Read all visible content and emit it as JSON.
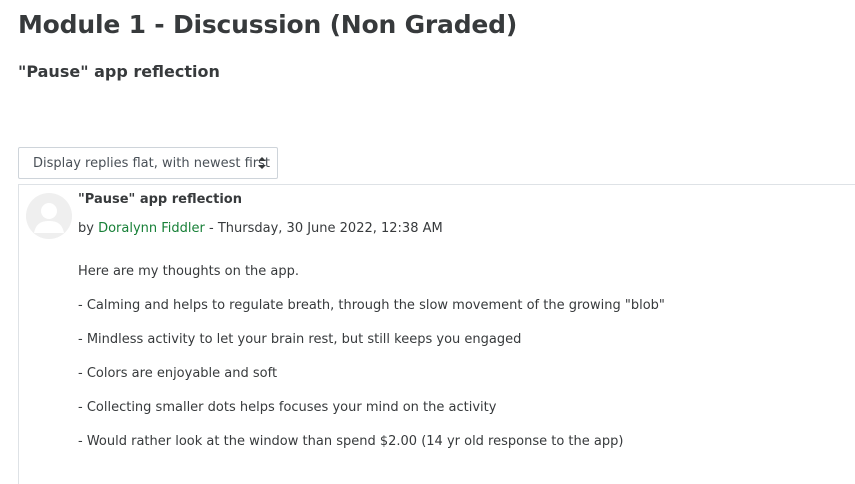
{
  "page": {
    "title": "Module 1 - Discussion (Non Graded)",
    "subtitle": "\"Pause\" app reflection"
  },
  "display_mode": {
    "selected": "Display replies flat, with newest first",
    "icon": "sort-caret-icon"
  },
  "post": {
    "subject": "\"Pause\" app reflection",
    "by_prefix": "by ",
    "author": "Doralynn Fiddler",
    "date_text": " - Thursday, 30 June 2022, 12:38 AM",
    "avatar_icon": "user-avatar-icon",
    "paragraphs": [
      "Here are my thoughts on the app.",
      "- Calming and helps to regulate breath, through the slow movement of the growing \"blob\"",
      "- Mindless activity to let your brain rest, but still keeps you engaged",
      "- Colors are enjoyable and soft",
      "- Collecting smaller dots helps focuses your mind on the activity",
      "- Would rather look at the window than spend $2.00 (14 yr old response to the app)"
    ]
  },
  "colors": {
    "text": "#373a3c",
    "author_link": "#188038",
    "border": "#dee2e6"
  }
}
